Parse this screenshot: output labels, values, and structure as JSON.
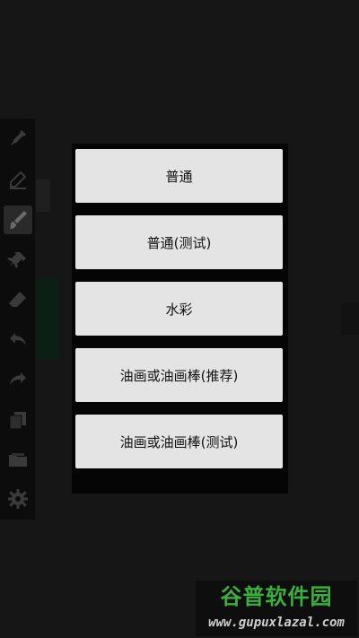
{
  "brush_menu": {
    "options": [
      {
        "label": "普通"
      },
      {
        "label": "普通(测试)"
      },
      {
        "label": "水彩"
      },
      {
        "label": "油画或油画棒(推荐)"
      },
      {
        "label": "油画或油画棒(测试)"
      }
    ]
  },
  "toolbar": {
    "tools": [
      {
        "icon": "eyedropper-icon"
      },
      {
        "icon": "pencil-outline-icon"
      },
      {
        "icon": "brush-icon",
        "selected": true
      },
      {
        "icon": "stamp-icon"
      },
      {
        "icon": "eraser-icon"
      },
      {
        "icon": "undo-icon"
      },
      {
        "icon": "redo-icon"
      },
      {
        "icon": "layers-icon"
      },
      {
        "icon": "folder-icon"
      },
      {
        "icon": "settings-gear-icon"
      }
    ]
  },
  "watermark": {
    "title": "谷普软件园",
    "url": "www.gupuxlazal.com"
  },
  "colors": {
    "background": "#161616",
    "dialog": "#050505",
    "option_bg": "#e4e4e4",
    "watermark_green": "#3cae3e"
  }
}
